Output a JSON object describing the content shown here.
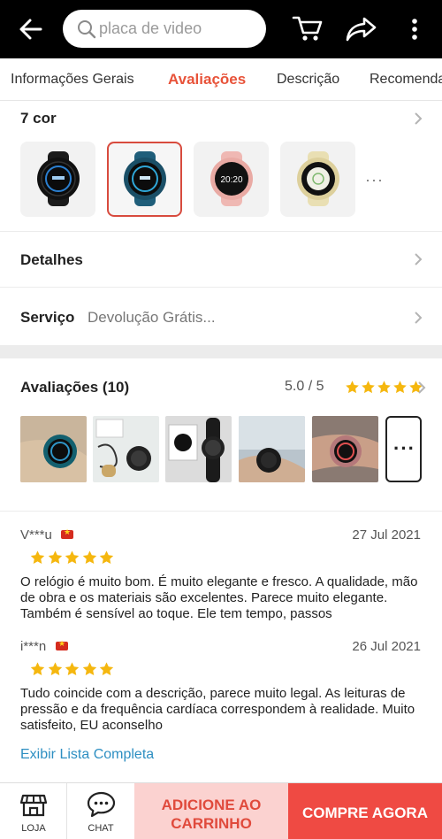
{
  "header": {
    "search_placeholder": "placa de video",
    "icons": [
      "back-arrow-icon",
      "search-icon",
      "cart-icon",
      "share-icon",
      "more-vertical-icon"
    ]
  },
  "tabs": [
    {
      "label": "Informações Gerais",
      "active": false
    },
    {
      "label": "Avaliações",
      "active": true
    },
    {
      "label": "Descrição",
      "active": false
    },
    {
      "label": "Recomendações",
      "active": false
    }
  ],
  "colors_section": {
    "title": "7 cor",
    "swatches": [
      {
        "name": "black",
        "color": "#1b1b1b",
        "face_time": "",
        "selected": false
      },
      {
        "name": "blue",
        "color": "#1f5e7a",
        "face_time": "",
        "selected": true
      },
      {
        "name": "pink",
        "color": "#efb8b3",
        "face_time": "20:20",
        "selected": false
      },
      {
        "name": "cream",
        "color": "#e9dfb3",
        "face_time": "",
        "selected": false
      }
    ],
    "more": "···"
  },
  "details": {
    "title": "Detalhes"
  },
  "service": {
    "title": "Serviço",
    "value": "Devolução Grátis..."
  },
  "reviews": {
    "title": "Avaliações (10)",
    "score": "5.0 / 5",
    "rating": 5,
    "more_photos": "···",
    "items": [
      {
        "reviewer": "V***u",
        "date": "27 Jul 2021",
        "rating": 5,
        "text": "O relógio é muito bom. É muito elegante e fresco. A qualidade, mão de obra e os materiais são excelentes. Parece muito elegante. Também é sensível ao toque. Ele tem tempo, passos"
      },
      {
        "reviewer": "i***n",
        "date": "26 Jul 2021",
        "rating": 5,
        "text": "Tudo coincide com a descrição, parece muito legal. As leituras de pressão e da frequência cardíaca correspondem à realidade. Muito satisfeito, EU aconselho"
      }
    ],
    "full_list_link": "Exibir Lista Completa"
  },
  "bottom_bar": {
    "store_label": "LOJA",
    "chat_label": "CHAT",
    "add_to_cart": "ADICIONE AO CARRINHO",
    "buy_now": "COMPRE AGORA"
  },
  "theme": {
    "accent": "#e8533a",
    "star": "#f5b70f",
    "link": "#2e8fc2",
    "buy": "#ef4a43",
    "cart_bg": "#fbd2d0"
  }
}
